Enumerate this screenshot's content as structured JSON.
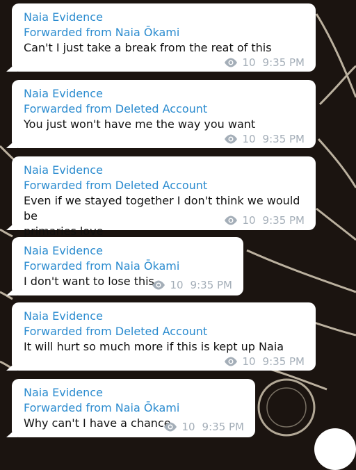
{
  "messages": [
    {
      "sender": "Naia Evidence",
      "forwarded": "Forwarded from Naia Ōkami",
      "text": "Can't I just take a break from the reat of this",
      "views": "10",
      "time": "9:35 PM"
    },
    {
      "sender": "Naia Evidence",
      "forwarded": "Forwarded from Deleted Account",
      "text": "You just won't have me the way you want",
      "views": "10",
      "time": "9:35 PM"
    },
    {
      "sender": "Naia Evidence",
      "forwarded": "Forwarded from Deleted Account",
      "text": "Even if we stayed together I don't think we would be\nprimaries love",
      "views": "10",
      "time": "9:35 PM"
    },
    {
      "sender": "Naia Evidence",
      "forwarded": "Forwarded from Naia Ōkami",
      "text": "I don't want to lose this",
      "views": "10",
      "time": "9:35 PM"
    },
    {
      "sender": "Naia Evidence",
      "forwarded": "Forwarded from Deleted Account",
      "text": "It will hurt so much more if this is kept up Naia",
      "views": "10",
      "time": "9:35 PM"
    },
    {
      "sender": "Naia Evidence",
      "forwarded": "Forwarded from Naia Ōkami",
      "text": "Why can't I have a chance",
      "views": "10",
      "time": "9:35 PM"
    }
  ],
  "icons": {
    "views": "eye-icon",
    "scroll_down": "scroll-down-button"
  },
  "colors": {
    "sender": "#2a8bcf",
    "text": "#111111",
    "meta": "#a4aeb8",
    "bubble": "#ffffff",
    "background": "#1b1410"
  }
}
